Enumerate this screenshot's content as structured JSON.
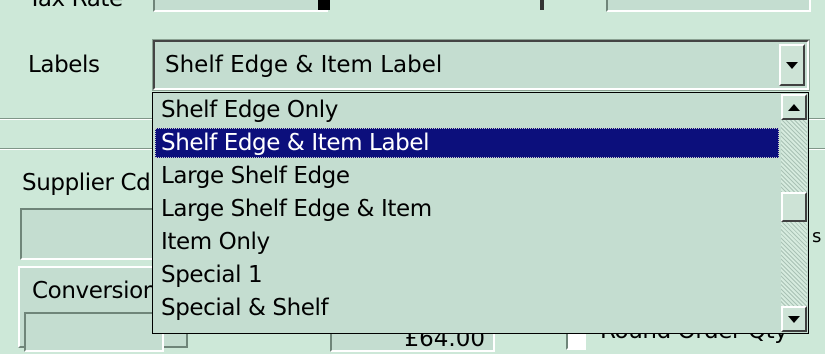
{
  "form": {
    "tax_rate_label": "Tax Rate",
    "labels_label": "Labels",
    "supplier_label": "Supplier Cd",
    "conversion_label": "Conversion",
    "amount_value": "£64.00",
    "round_order_label": "Round Order Qty",
    "partial_s": "s"
  },
  "labels_combo": {
    "selected": "Shelf Edge & Item Label",
    "options": [
      "Shelf Edge Only",
      "Shelf Edge & Item Label",
      "Large Shelf Edge",
      "Large Shelf Edge & Item",
      "Item Only",
      "Special 1",
      "Special & Shelf"
    ],
    "highlighted_index": 1
  },
  "colors": {
    "background": "#cde8d8",
    "highlight": "#0c0f7c"
  }
}
